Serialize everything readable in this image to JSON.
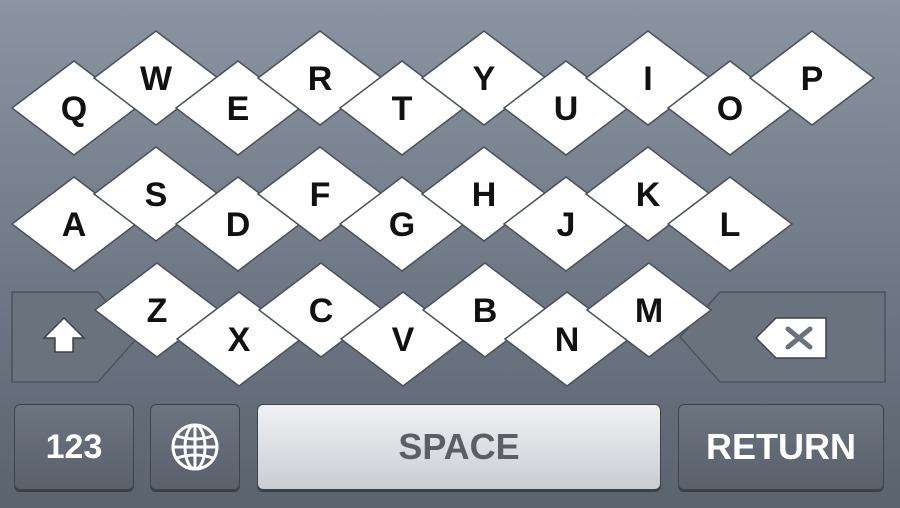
{
  "keyboard": {
    "rows": [
      [
        "Q",
        "W",
        "E",
        "R",
        "T",
        "Y",
        "U",
        "I",
        "O",
        "P"
      ],
      [
        "A",
        "S",
        "D",
        "F",
        "G",
        "H",
        "J",
        "K",
        "L"
      ],
      [
        "Z",
        "X",
        "C",
        "V",
        "B",
        "N",
        "M"
      ]
    ],
    "shift": {
      "icon": "shift-arrow-icon"
    },
    "backspace": {
      "icon": "backspace-icon"
    },
    "numbers_label": "123",
    "globe": {
      "icon": "globe-icon"
    },
    "space_label": "SPACE",
    "return_label": "RETURN"
  }
}
